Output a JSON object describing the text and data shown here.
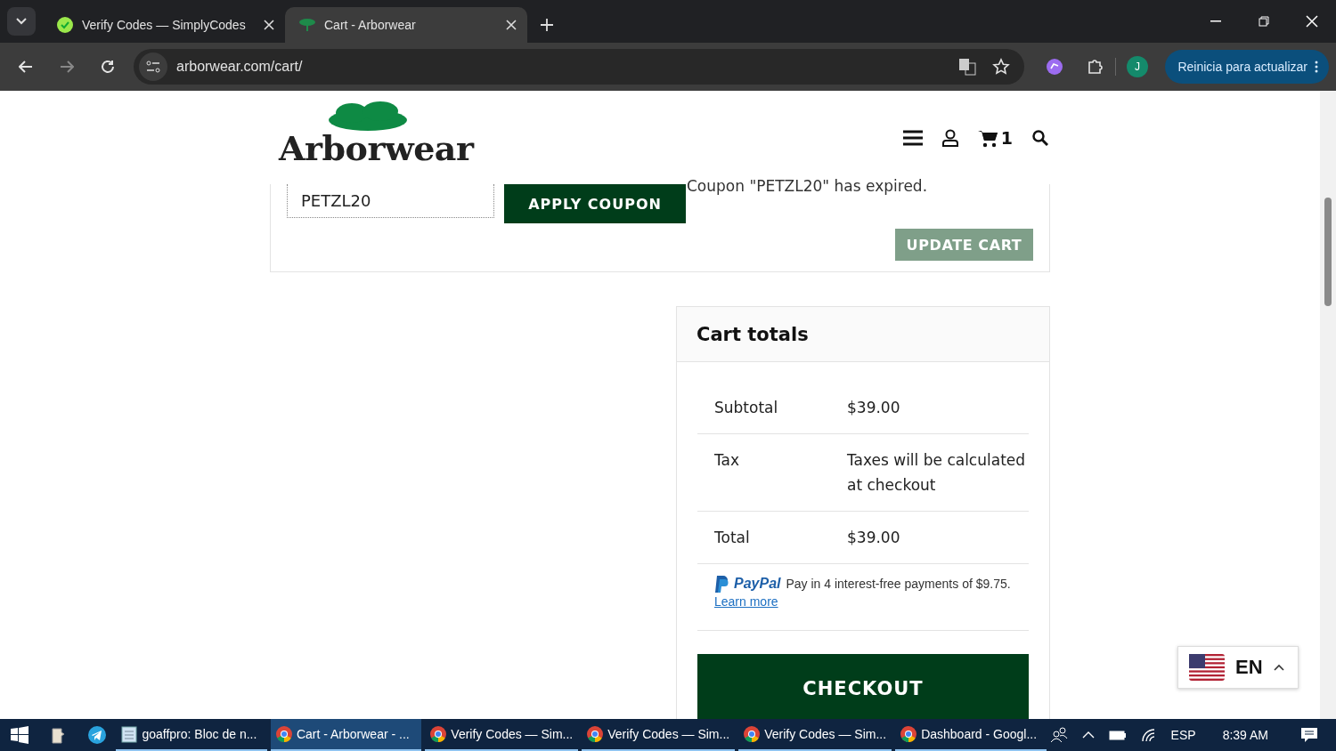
{
  "browser": {
    "tabs": [
      {
        "title": "Verify Codes — SimplyCodes",
        "selected": false,
        "kind": "badge"
      },
      {
        "title": "Cart - Arborwear",
        "selected": true,
        "kind": "tree"
      }
    ],
    "url": "arborwear.com/cart/",
    "profile_initial": "J",
    "update_button": "Reinicia para actualizar"
  },
  "site": {
    "logo": "Arborwear",
    "cart_count": "1",
    "coupon": {
      "value": "PETZL20",
      "apply": "APPLY COUPON",
      "message": "Coupon \"PETZL20\" has expired."
    },
    "update_cart": "UPDATE CART",
    "cart_totals": {
      "title": "Cart totals",
      "rows": [
        {
          "label": "Subtotal",
          "value": "$39.00"
        },
        {
          "label": "Tax",
          "value": "Taxes will be calculated at checkout"
        },
        {
          "label": "Total",
          "value": "$39.00"
        }
      ],
      "paypal": {
        "brand": "PayPal",
        "text": "Pay in 4 interest-free payments of $9.75.",
        "link": "Learn more"
      },
      "checkout": "CHECKOUT"
    },
    "language": {
      "code": "EN"
    }
  },
  "taskbar": {
    "items": [
      {
        "label": "goaffpro: Bloc de n...",
        "selected": false,
        "kind": "notepad"
      },
      {
        "label": "Cart - Arborwear - ...",
        "selected": true,
        "kind": "chrome"
      },
      {
        "label": "Verify Codes — Sim...",
        "selected": false,
        "kind": "chrome"
      },
      {
        "label": "Verify Codes — Sim...",
        "selected": false,
        "kind": "chrome"
      },
      {
        "label": "Verify Codes — Sim...",
        "selected": false,
        "kind": "chrome"
      },
      {
        "label": "Dashboard - Googl...",
        "selected": false,
        "kind": "chrome"
      }
    ],
    "tray": {
      "language": "ESP",
      "time": "8:39 AM"
    }
  }
}
